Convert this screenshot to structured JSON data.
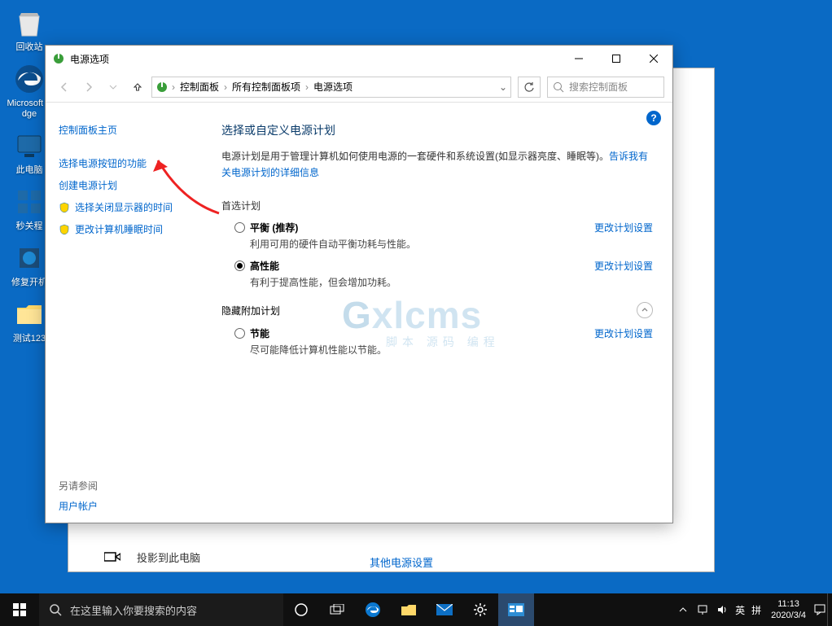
{
  "desktop": {
    "icons": [
      "回收站",
      "Microsoft Edge",
      "此电脑",
      "秒关程",
      "修复开机",
      "测试123"
    ]
  },
  "settings_back": {
    "project_label": "投影到此电脑",
    "other_power": "其他电源设置"
  },
  "window": {
    "title": "电源选项",
    "breadcrumb": [
      "控制面板",
      "所有控制面板项",
      "电源选项"
    ],
    "search_placeholder": "搜索控制面板"
  },
  "sidebar": {
    "home": "控制面板主页",
    "links": [
      "选择电源按钮的功能",
      "创建电源计划",
      "选择关闭显示器的时间",
      "更改计算机睡眠时间"
    ],
    "see_also_hdr": "另请参阅",
    "see_also_link": "用户帐户"
  },
  "content": {
    "heading": "选择或自定义电源计划",
    "intro_prefix": "电源计划是用于管理计算机如何使用电源的一套硬件和系统设置(如显示器亮度、睡眠等)。",
    "intro_link": "告诉我有关电源计划的详细信息",
    "preferred_hdr": "首选计划",
    "hidden_hdr": "隐藏附加计划",
    "change_link": "更改计划设置",
    "plans": [
      {
        "name": "平衡 (推荐)",
        "desc": "利用可用的硬件自动平衡功耗与性能。",
        "checked": false
      },
      {
        "name": "高性能",
        "desc": "有利于提高性能，但会增加功耗。",
        "checked": true
      }
    ],
    "hidden_plans": [
      {
        "name": "节能",
        "desc": "尽可能降低计算机性能以节能。",
        "checked": false
      }
    ]
  },
  "watermark": {
    "main": "Gxlcms",
    "sub": "脚本 源码 编程"
  },
  "taskbar": {
    "search_placeholder": "在这里输入你要搜索的内容",
    "ime1": "英",
    "ime2": "拼",
    "time": "11:13",
    "date": "2020/3/4"
  }
}
